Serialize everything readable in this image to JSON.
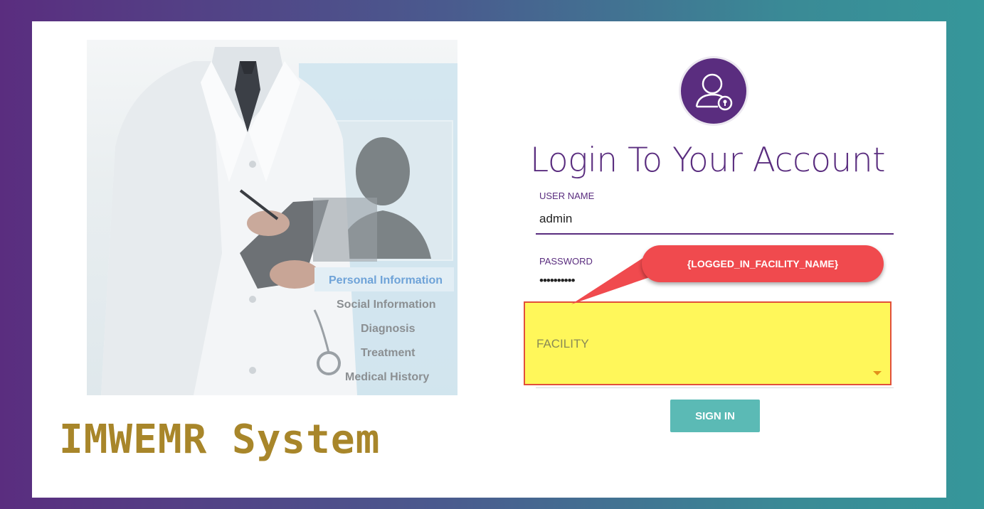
{
  "brand": {
    "name": "IMWEMR System"
  },
  "illustration": {
    "menu": [
      {
        "label": "Personal  Information",
        "active": true
      },
      {
        "label": "Social  Information",
        "active": false
      },
      {
        "label": "Diagnosis",
        "active": false
      },
      {
        "label": "Treatment",
        "active": false
      },
      {
        "label": "Medical History",
        "active": false
      }
    ]
  },
  "login": {
    "title": "Login To Your Account",
    "avatar_icon": "user-lock-icon",
    "username": {
      "label": "USER NAME",
      "value": "admin"
    },
    "password": {
      "label": "PASSWORD",
      "value": "••••••••••"
    },
    "facility": {
      "label": "FACILITY",
      "caret_icon": "caret-down-icon"
    },
    "signin_label": "SIGN IN"
  },
  "callout": {
    "text": "{LOGGED_IN_FACILITY_NAME}"
  },
  "colors": {
    "brand_purple": "#5a2d7f",
    "brand_teal": "#36979a",
    "brand_gold": "#a8862a",
    "button": "#5bbab5",
    "highlight": "#fff75a",
    "callout": "#f04a4e"
  }
}
